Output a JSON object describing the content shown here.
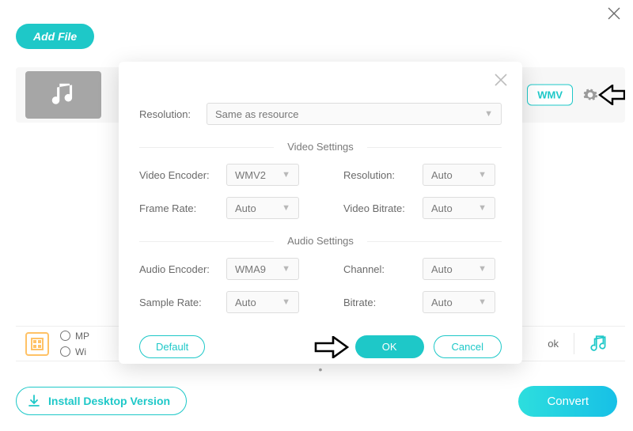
{
  "header": {
    "add_file": "Add File"
  },
  "strip": {
    "format_badge": "WMV"
  },
  "bottom": {
    "radio1": "MP",
    "radio2": "Wi",
    "ok_hint": "ok"
  },
  "footer": {
    "install": "Install Desktop Version",
    "convert": "Convert"
  },
  "modal": {
    "resolution_label": "Resolution:",
    "resolution_value": "Same as resource",
    "video_section": "Video Settings",
    "audio_section": "Audio Settings",
    "video_encoder_label": "Video Encoder:",
    "video_encoder_value": "WMV2",
    "frame_rate_label": "Frame Rate:",
    "frame_rate_value": "Auto",
    "v_resolution_label": "Resolution:",
    "v_resolution_value": "Auto",
    "video_bitrate_label": "Video Bitrate:",
    "video_bitrate_value": "Auto",
    "audio_encoder_label": "Audio Encoder:",
    "audio_encoder_value": "WMA9",
    "sample_rate_label": "Sample Rate:",
    "sample_rate_value": "Auto",
    "channel_label": "Channel:",
    "channel_value": "Auto",
    "a_bitrate_label": "Bitrate:",
    "a_bitrate_value": "Auto",
    "default_btn": "Default",
    "ok_btn": "OK",
    "cancel_btn": "Cancel"
  }
}
